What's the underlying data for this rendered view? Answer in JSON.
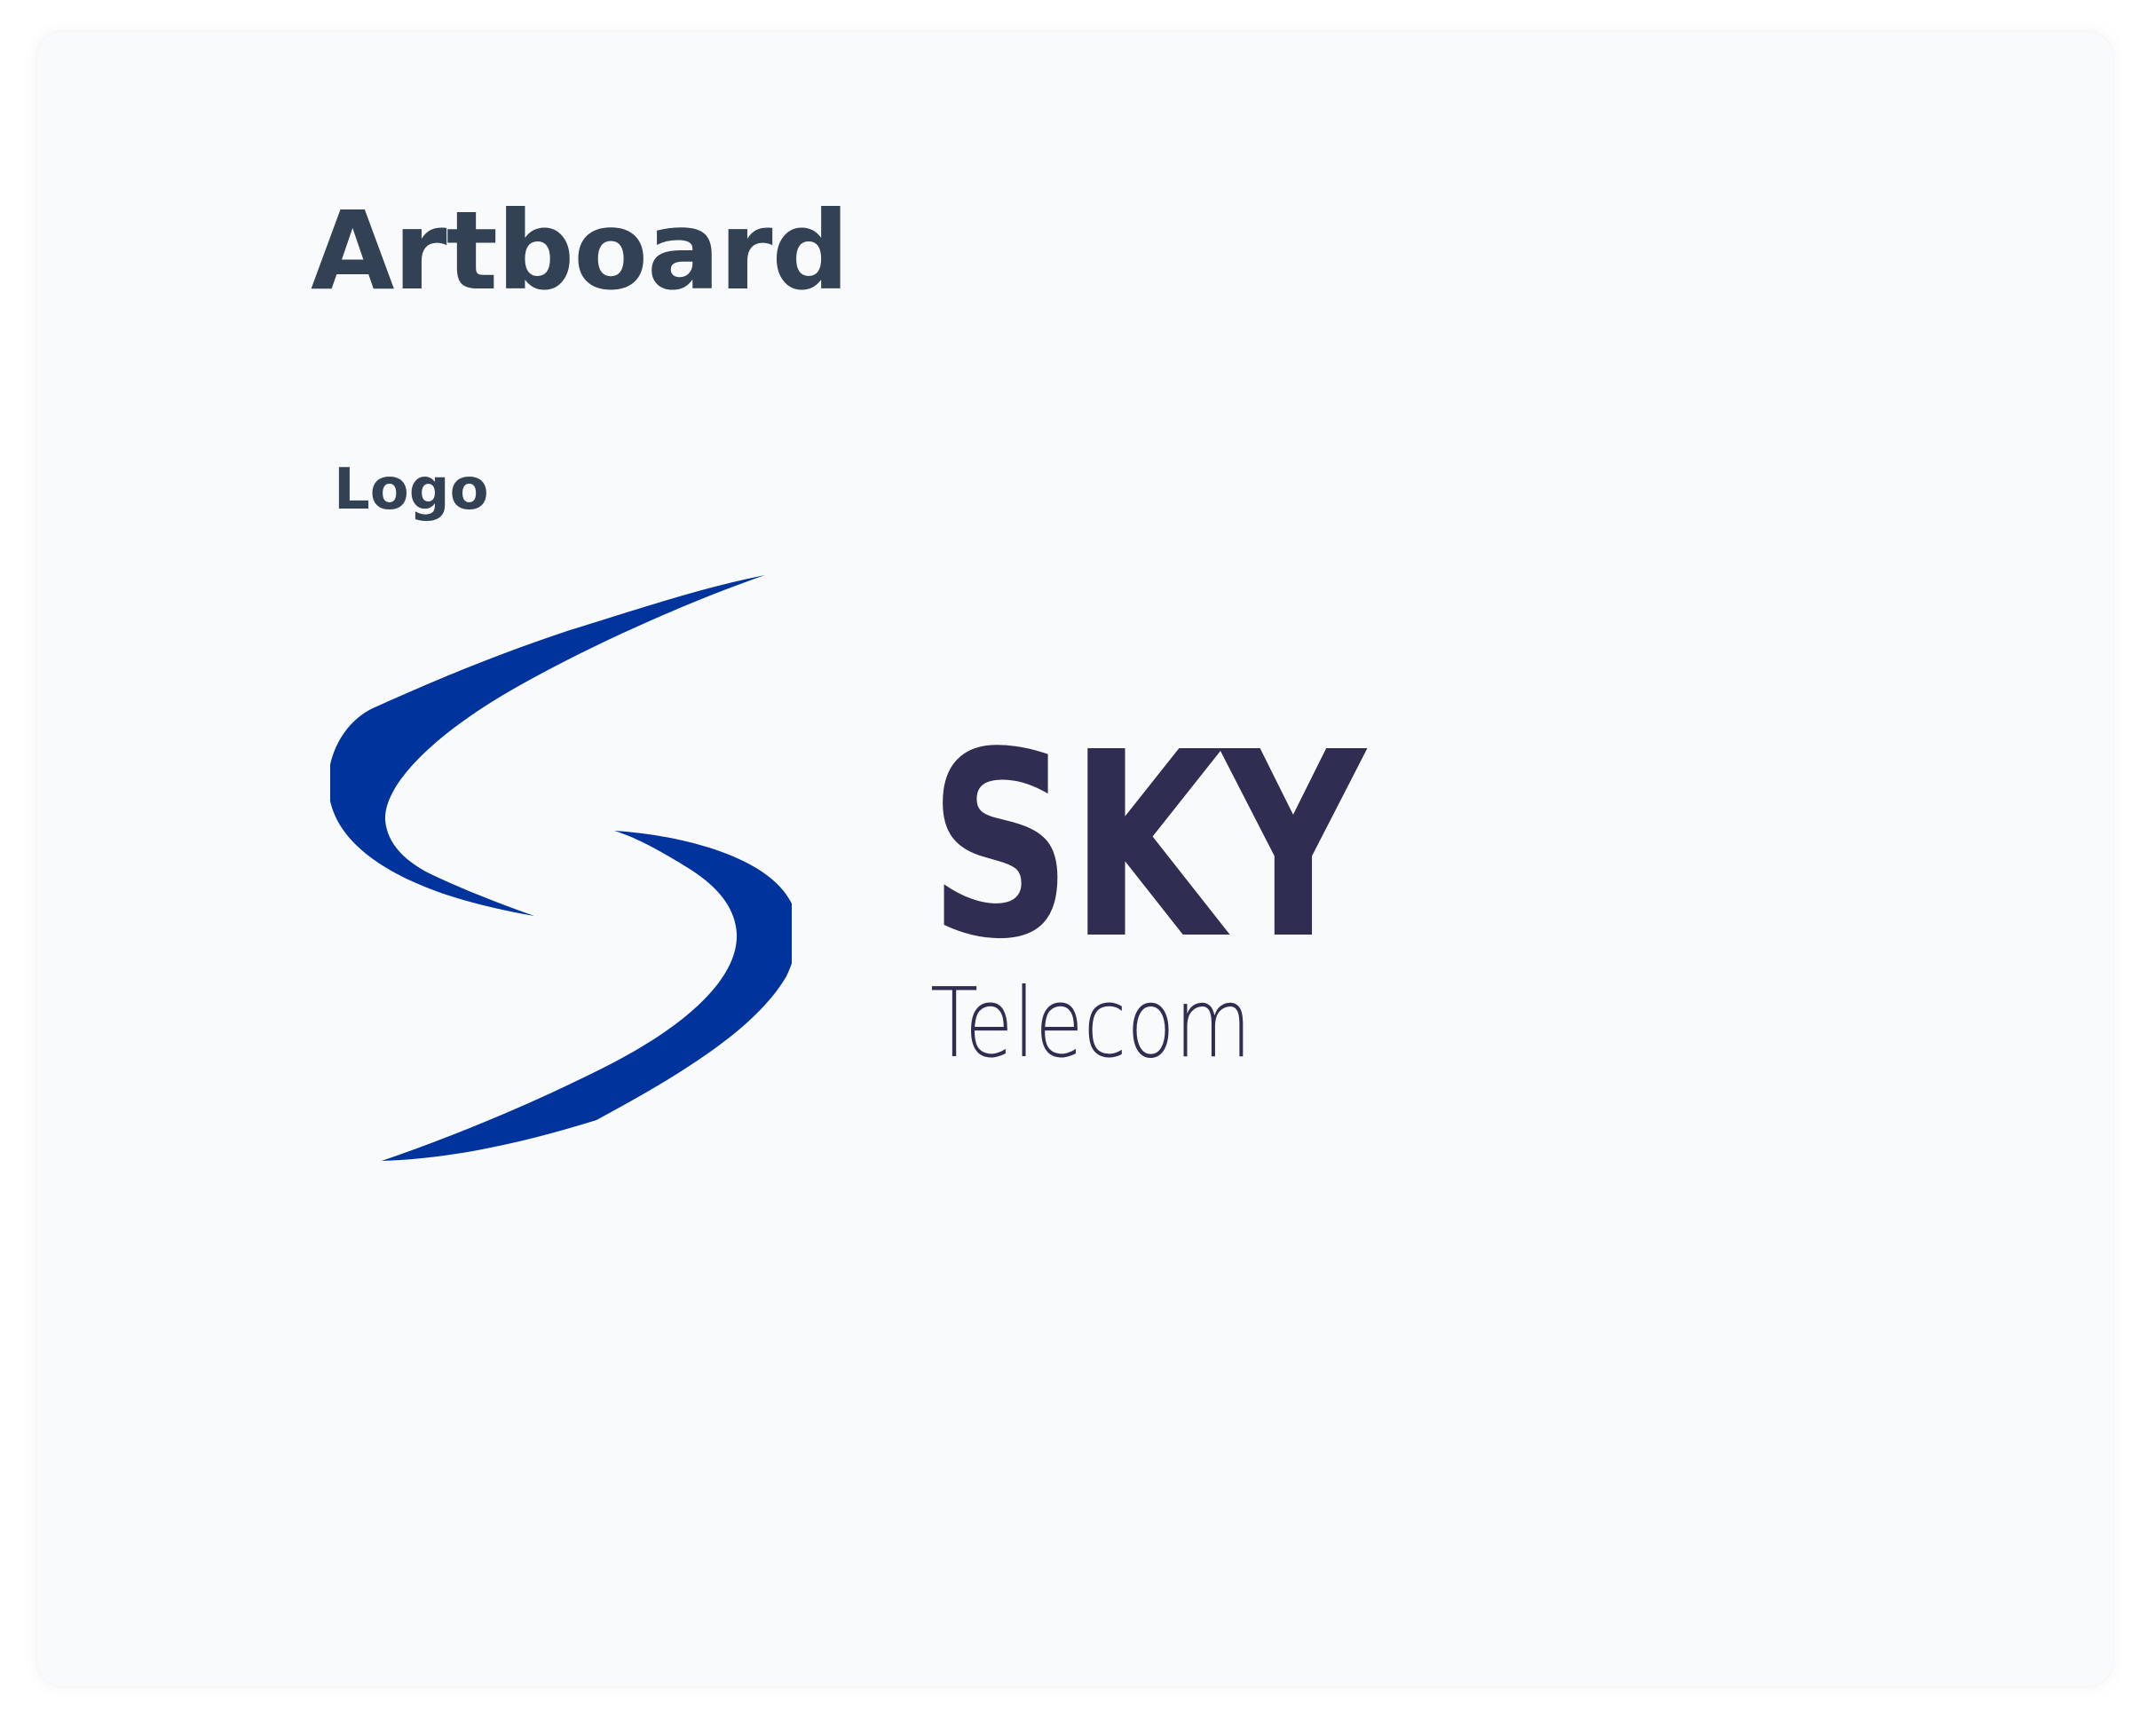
{
  "artboard": {
    "title": "Artboard",
    "section_label": "Logo"
  },
  "logo": {
    "mark_icon": "swoosh-s-icon",
    "wordmark_primary": "SKY",
    "wordmark_secondary": "Telecom"
  },
  "colors": {
    "canvas_background": "#f8fafc",
    "title_text": "#334155",
    "mark_blue": "#00349c",
    "wordmark": "#302d52"
  }
}
